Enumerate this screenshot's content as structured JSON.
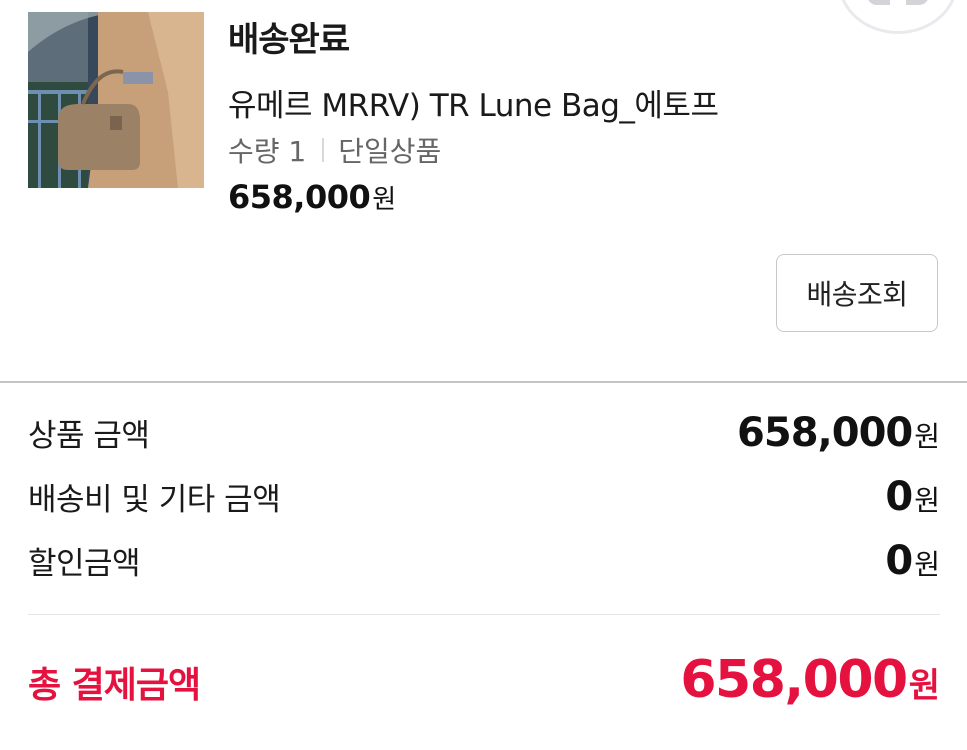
{
  "order": {
    "status": "배송완료",
    "product_name": "유메르 MRRV) TR Lune Bag_에토프",
    "quantity_text": "수량 1",
    "option_text": "단일상품",
    "price_value": "658,000",
    "price_unit": "원",
    "track_button_label": "배송조회"
  },
  "summary": {
    "rows": [
      {
        "label": "상품 금액",
        "value": "658,000",
        "unit": "원"
      },
      {
        "label": "배송비 및 기타 금액",
        "value": "0",
        "unit": "원"
      },
      {
        "label": "할인금액",
        "value": "0",
        "unit": "원"
      }
    ],
    "total": {
      "label": "총 결제금액",
      "value": "658,000",
      "unit": "원"
    }
  },
  "colors": {
    "accent": "#e5113f",
    "text": "#1a1a1a",
    "muted": "#666666",
    "divider": "#c4c4c4"
  }
}
